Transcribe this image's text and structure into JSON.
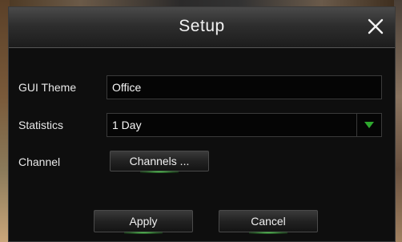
{
  "dialog": {
    "title": "Setup"
  },
  "form": {
    "gui_theme": {
      "label": "GUI Theme",
      "value": "Office"
    },
    "statistics": {
      "label": "Statistics",
      "value": "1 Day"
    },
    "channel": {
      "label": "Channel",
      "button_label": "Channels ..."
    }
  },
  "footer": {
    "apply_label": "Apply",
    "cancel_label": "Cancel"
  },
  "icons": {
    "close": "close-icon",
    "dropdown": "triangle-down-icon"
  },
  "colors": {
    "accent_green": "#2ea82e"
  }
}
